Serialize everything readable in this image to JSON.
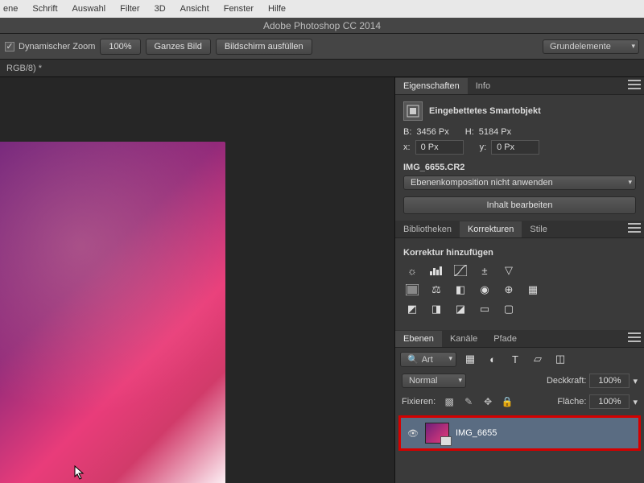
{
  "menubar": [
    "ene",
    "Schrift",
    "Auswahl",
    "Filter",
    "3D",
    "Ansicht",
    "Fenster",
    "Hilfe"
  ],
  "title": "Adobe Photoshop CC 2014",
  "options": {
    "dynZoom": "Dynamischer Zoom",
    "zoom": "100%",
    "fit": "Ganzes Bild",
    "fill": "Bildschirm ausfüllen",
    "workspace": "Grundelemente"
  },
  "doctab": "RGB/8) *",
  "props": {
    "tab1": "Eigenschaften",
    "tab2": "Info",
    "so": "Eingebettetes Smartobjekt",
    "Blabel": "B:",
    "B": "3456 Px",
    "Hlabel": "H:",
    "H": "5184 Px",
    "xlabel": "x:",
    "x": "0 Px",
    "ylabel": "y:",
    "y": "0 Px",
    "filename": "IMG_6655.CR2",
    "comp": "Ebenenkomposition nicht anwenden",
    "edit": "Inhalt bearbeiten"
  },
  "adjust": {
    "tab1": "Bibliotheken",
    "tab2": "Korrekturen",
    "tab3": "Stile",
    "header": "Korrektur hinzufügen"
  },
  "layers": {
    "tab1": "Ebenen",
    "tab2": "Kanäle",
    "tab3": "Pfade",
    "filter": "Art",
    "blend": "Normal",
    "opacityLabel": "Deckkraft:",
    "opacity": "100%",
    "lockLabel": "Fixieren:",
    "fillLabel": "Fläche:",
    "fill": "100%",
    "layerName": "IMG_6655"
  }
}
